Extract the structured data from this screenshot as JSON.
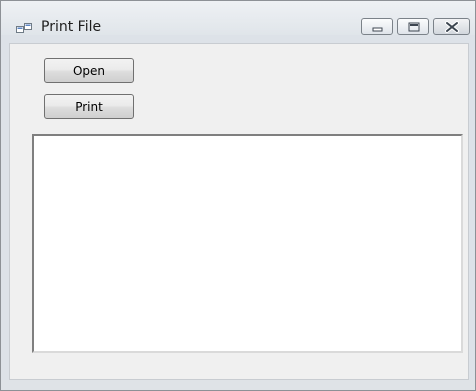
{
  "window": {
    "title": "Print File",
    "controls": {
      "minimize": "minimize",
      "maximize": "maximize",
      "close": "close"
    }
  },
  "buttons": {
    "open_label": "Open",
    "print_label": "Print"
  },
  "textbox": {
    "value": ""
  },
  "icons": {
    "app": "window-app-icon",
    "minimize": "minimize-icon",
    "maximize": "maximize-icon",
    "close": "close-icon"
  },
  "colors": {
    "window_frame": "#dde2e8",
    "client_background": "#f0f0f0",
    "textbox_background": "#ffffff"
  }
}
